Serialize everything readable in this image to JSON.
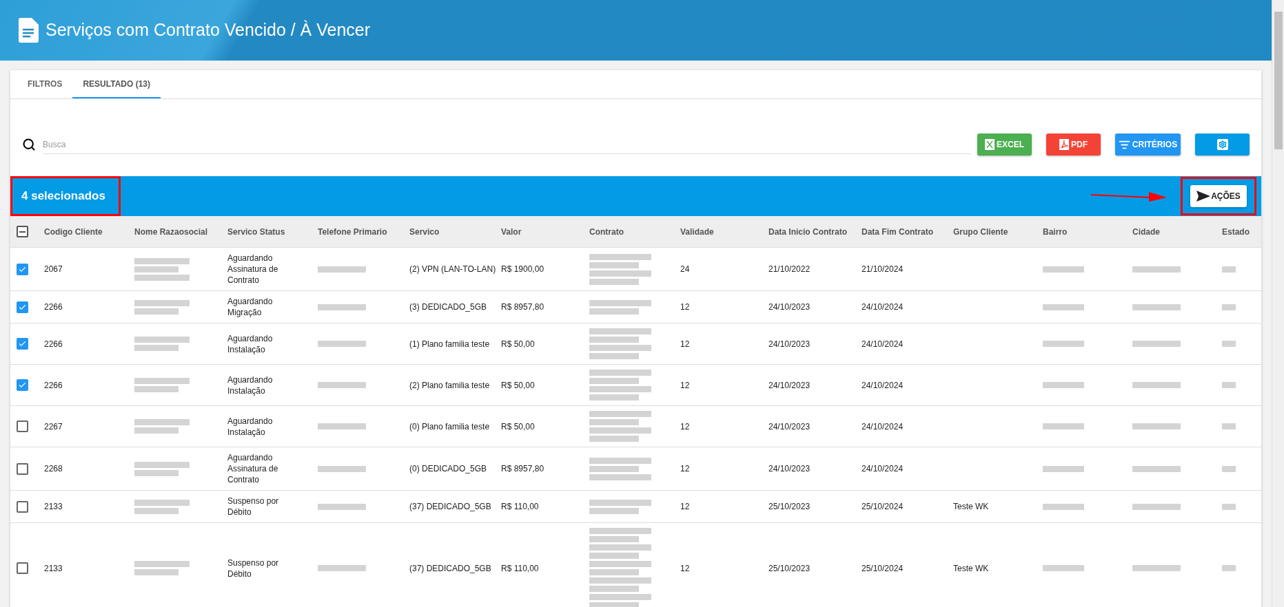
{
  "header": {
    "title": "Serviços com Contrato Vencido / À Vencer"
  },
  "tabs": [
    {
      "label": "FILTROS",
      "selected": false
    },
    {
      "label": "RESULTADO (13)",
      "selected": true
    }
  ],
  "search": {
    "placeholder": "Busca"
  },
  "toolbar_buttons": [
    {
      "kind": "excel",
      "label": "EXCEL"
    },
    {
      "kind": "pdf",
      "label": "PDF"
    },
    {
      "kind": "criteria",
      "label": "CRITÉRIOS"
    },
    {
      "kind": "settings"
    }
  ],
  "selection_bar": {
    "count_text": "4 selecionados",
    "action_button": "AÇÕES"
  },
  "table": {
    "select_all": {
      "indeterminate": true
    },
    "columns": [
      "Codigo Cliente",
      "Nome Razaosocial",
      "Servico Status",
      "Telefone Primario",
      "Servico",
      "Valor",
      "Contrato",
      "Validade",
      "Data Inicio Contrato",
      "Data Fim Contrato",
      "Grupo Cliente",
      "Bairro",
      "Cidade",
      "Estado"
    ],
    "rows": [
      {
        "checked": true,
        "codigo": "2067",
        "status": "Aguardando Assinatura de Contrato",
        "servico": "(2) VPN (LAN-TO-LAN)",
        "valor": "R$ 1900,00",
        "validade": "24",
        "inicio": "21/10/2022",
        "fim": "21/10/2024",
        "grupo": ""
      },
      {
        "checked": true,
        "codigo": "2266",
        "status": "Aguardando Migração",
        "servico": "(3) DEDICADO_5GB",
        "valor": "R$ 8957,80",
        "validade": "12",
        "inicio": "24/10/2023",
        "fim": "24/10/2024",
        "grupo": ""
      },
      {
        "checked": true,
        "codigo": "2266",
        "status": "Aguardando Instalação",
        "servico": "(1) Plano familia teste",
        "valor": "R$ 50,00",
        "validade": "12",
        "inicio": "24/10/2023",
        "fim": "24/10/2024",
        "grupo": ""
      },
      {
        "checked": true,
        "codigo": "2266",
        "status": "Aguardando Instalação",
        "servico": "(2) Plano familia teste",
        "valor": "R$ 50,00",
        "validade": "12",
        "inicio": "24/10/2023",
        "fim": "24/10/2024",
        "grupo": ""
      },
      {
        "checked": false,
        "codigo": "2267",
        "status": "Aguardando Instalação",
        "servico": "(0) Plano familia teste",
        "valor": "R$ 50,00",
        "validade": "12",
        "inicio": "24/10/2023",
        "fim": "24/10/2024",
        "grupo": ""
      },
      {
        "checked": false,
        "codigo": "2268",
        "status": "Aguardando Assinatura de Contrato",
        "servico": "(0) DEDICADO_5GB",
        "valor": "R$ 8957,80",
        "validade": "12",
        "inicio": "24/10/2023",
        "fim": "24/10/2024",
        "grupo": ""
      },
      {
        "checked": false,
        "codigo": "2133",
        "status": "Suspenso por Débito",
        "servico": "(37) DEDICADO_5GB",
        "valor": "R$ 110,00",
        "validade": "12",
        "inicio": "25/10/2023",
        "fim": "25/10/2024",
        "grupo": "Teste WK"
      },
      {
        "checked": false,
        "codigo": "2133",
        "status": "Suspenso por Débito",
        "servico": "(37) DEDICADO_5GB",
        "valor": "R$ 110,00",
        "validade": "12",
        "inicio": "25/10/2023",
        "fim": "25/10/2024",
        "grupo": "Teste WK"
      }
    ]
  }
}
